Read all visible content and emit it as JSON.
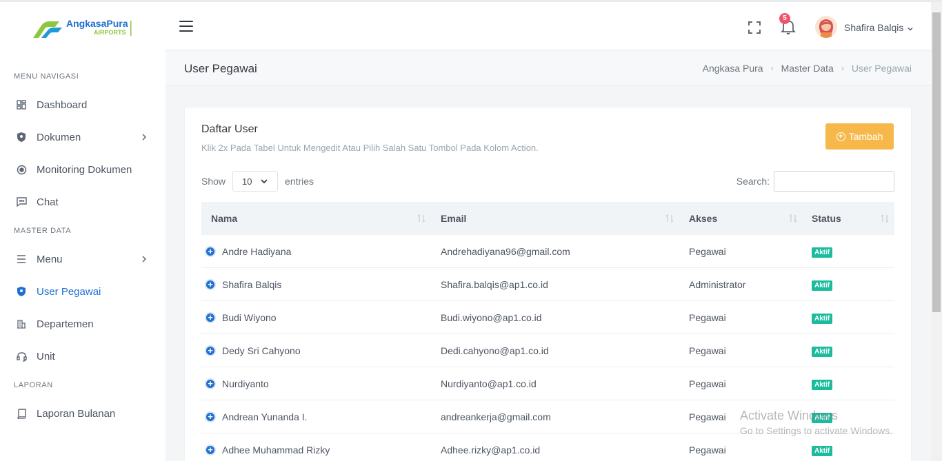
{
  "brand": {
    "name_top": "AngkasaPura",
    "name_bottom": "AIRPORTS",
    "color_green": "#8dc63f",
    "color_blue": "#1f6fd1"
  },
  "sidebar": {
    "section_nav": "MENU NAVIGASI",
    "section_master": "MASTER DATA",
    "section_report": "LAPORAN",
    "items": [
      {
        "label": "Dashboard",
        "icon": "dashboard-icon"
      },
      {
        "label": "Dokumen",
        "icon": "shield-icon"
      },
      {
        "label": "Monitoring Dokumen",
        "icon": "target-icon"
      },
      {
        "label": "Chat",
        "icon": "chat-icon"
      },
      {
        "label": "Menu",
        "icon": "list-icon"
      },
      {
        "label": "User Pegawai",
        "icon": "shield-icon",
        "active": true
      },
      {
        "label": "Departemen",
        "icon": "building-icon"
      },
      {
        "label": "Unit",
        "icon": "headset-icon"
      },
      {
        "label": "Laporan Bulanan",
        "icon": "book-icon"
      }
    ]
  },
  "header": {
    "notification_count": "5",
    "user_name": "Shafira Balqis"
  },
  "page": {
    "title": "User Pegawai",
    "breadcrumb": [
      "Angkasa Pura",
      "Master Data",
      "User Pegawai"
    ]
  },
  "card": {
    "title": "Daftar User",
    "subtitle": "Klik 2x Pada Tabel Untuk Mengedit Atau Pilih Salah Satu Tombol Pada Kolom Action.",
    "add_button": "Tambah",
    "show_label": "Show",
    "entries_value": "10",
    "entries_label": "entries",
    "search_label": "Search:",
    "search_value": ""
  },
  "table": {
    "columns": [
      "Nama",
      "Email",
      "Akses",
      "Status"
    ],
    "rows": [
      {
        "nama": "Andre Hadiyana",
        "email": "Andrehadiyana96@gmail.com",
        "akses": "Pegawai",
        "status": "Aktif"
      },
      {
        "nama": "Shafira Balqis",
        "email": "Shafira.balqis@ap1.co.id",
        "akses": "Administrator",
        "status": "Aktif"
      },
      {
        "nama": "Budi Wiyono",
        "email": "Budi.wiyono@ap1.co.id",
        "akses": "Pegawai",
        "status": "Aktif"
      },
      {
        "nama": "Dedy Sri Cahyono",
        "email": "Dedi.cahyono@ap1.co.id",
        "akses": "Pegawai",
        "status": "Aktif"
      },
      {
        "nama": "Nurdiyanto",
        "email": "Nurdiyanto@ap1.co.id",
        "akses": "Pegawai",
        "status": "Aktif"
      },
      {
        "nama": "Andrean Yunanda I.",
        "email": "andreankerja@gmail.com",
        "akses": "Pegawai",
        "status": "Aktif"
      },
      {
        "nama": "Adhee Muhammad Rizky",
        "email": "Adhee.rizky@ap1.co.id",
        "akses": "Pegawai",
        "status": "Aktif"
      }
    ]
  },
  "watermark": {
    "line1": "Activate Windows",
    "line2": "Go to Settings to activate Windows."
  },
  "colors": {
    "accent": "#1f6fd1",
    "warning": "#f7b84b",
    "success": "#1abc9c",
    "danger": "#f1556c"
  }
}
